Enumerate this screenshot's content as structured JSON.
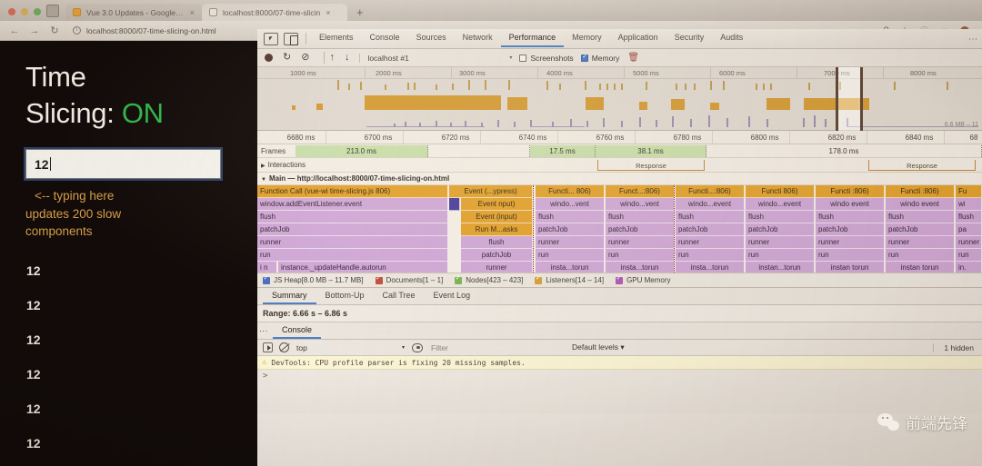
{
  "browser": {
    "tabs": [
      {
        "title": "Vue 3.0 Updates - Google Sli",
        "close": "×"
      },
      {
        "title": "localhost:8000/07-time-slicin",
        "close": "×"
      }
    ],
    "new_tab": "+",
    "back": "←",
    "forward": "→",
    "reload": "↻",
    "url": "localhost:8000/07-time-slicing-on.html",
    "info_icon": "i",
    "omni": {
      "search": "⚲",
      "bookmark": "☆",
      "account": "ⓘ",
      "extension": "▼"
    }
  },
  "page": {
    "title_line1": "Time",
    "title_line2": "Slicing: ",
    "title_state": "ON",
    "input_value": "12",
    "hint_arrow": "<-- typing here",
    "hint_line2": "updates 200 slow",
    "hint_line3": "components",
    "numbers": [
      "12",
      "12",
      "12",
      "12",
      "12",
      "12"
    ]
  },
  "devtools": {
    "tabs": [
      {
        "label": "Elements",
        "active": false
      },
      {
        "label": "Console",
        "active": false
      },
      {
        "label": "Sources",
        "active": false
      },
      {
        "label": "Network",
        "active": false
      },
      {
        "label": "Performance",
        "active": true
      },
      {
        "label": "Memory",
        "active": false
      },
      {
        "label": "Application",
        "active": false
      },
      {
        "label": "Security",
        "active": false
      },
      {
        "label": "Audits",
        "active": false
      }
    ],
    "kebab": "⋮",
    "controls": {
      "record": "record",
      "reload_record": "↻",
      "clear": "⊘",
      "upload": "↑",
      "download": "↓",
      "target": "localhost #1",
      "caret": "▾",
      "screenshots_label": "Screenshots",
      "screenshots_checked": false,
      "memory_label": "Memory",
      "memory_checked": true,
      "trash": "🗑"
    },
    "overview": {
      "ticks": [
        "1000 ms",
        "2000 ms",
        "3000 ms",
        "4000 ms",
        "5000 ms",
        "6000 ms",
        "7000 ms",
        "8000 ms"
      ],
      "heap_label": "6.6 MB – 11",
      "selection_label": "7000 ms"
    },
    "timeline": {
      "ticks": [
        "6680 ms",
        "6700 ms",
        "6720 ms",
        "6740 ms",
        "6760 ms",
        "6780 ms",
        "6800 ms",
        "6820 ms",
        "6840 ms",
        "68"
      ],
      "frames_label": "Frames",
      "frames": [
        "213.0 ms",
        "17.5 ms",
        "38.1 ms",
        "178.0 ms"
      ],
      "interactions_label": "Interactions",
      "interaction_items": [
        "Response",
        "Response"
      ],
      "main_label": "Main — http://localhost:8000/07-time-slicing-on.html",
      "expand_tri": "▶",
      "collapse_tri": "▼"
    },
    "flame": {
      "group_a": {
        "top": "Function Call (vue-wi  time-slicing.js 806)",
        "rows": [
          "window.addEventListener.event",
          "flush",
          "patchJob",
          "runner",
          "run",
          "instance._updateHandle.autorun"
        ],
        "row6_prefix": "i   n"
      },
      "group_b": {
        "rows": [
          "Event (...ypress)",
          "Event    nput)",
          "Event (input)",
          "Run M...asks",
          "flush",
          "patchJob",
          "runner"
        ]
      },
      "group_c": {
        "top": "Functi...  806)",
        "rows": [
          "windo...vent",
          "flush",
          "patchJob",
          "runner",
          "run",
          "insta...torun"
        ]
      },
      "group_d": {
        "top": "Funct...:806)",
        "rows": [
          "windo...vent",
          "flush",
          "patchJob",
          "runner",
          "run",
          "insta...torun"
        ]
      },
      "group_e": {
        "top": "Functi...:806)",
        "rows": [
          "windo...event",
          "flush",
          "patchJob",
          "runner",
          "run",
          "insta...torun"
        ]
      },
      "group_f": {
        "top": "Functi   806)",
        "rows": [
          "windo...event",
          "flush",
          "patchJob",
          "runner",
          "run",
          "instan...torun"
        ]
      },
      "group_g": {
        "top": "Functi   :806)",
        "rows": [
          "windo   event",
          "flush",
          "patchJob",
          "runner",
          "run",
          "instan   torun"
        ]
      },
      "group_h": {
        "top": "Functi   :806)",
        "rows": [
          "windo   event",
          "flush",
          "patchJob",
          "runner",
          "run",
          "instan  torun"
        ]
      },
      "group_i": {
        "top": "Fu",
        "rows": [
          "wi",
          "flush",
          "pa",
          "runner",
          "run",
          "in."
        ]
      }
    },
    "counters": [
      {
        "label": "JS Heap[8.0 MB – 11.7 MB]",
        "color": "#4a6fc4"
      },
      {
        "label": "Documents[1 – 1]",
        "color": "#c0503c"
      },
      {
        "label": "Nodes[423 – 423]",
        "color": "#79b554"
      },
      {
        "label": "Listeners[14 – 14]",
        "color": "#d8a03c"
      },
      {
        "label": "GPU Memory",
        "color": "#b05bb8"
      }
    ],
    "bottom_tabs": [
      {
        "label": "Summary",
        "active": true
      },
      {
        "label": "Bottom-Up",
        "active": false
      },
      {
        "label": "Call Tree",
        "active": false
      },
      {
        "label": "Event Log",
        "active": false
      }
    ],
    "range": "Range: 6.66 s – 6.86 s",
    "drawer": {
      "kebab": "⋮",
      "tab": "Console"
    },
    "console": {
      "context": "top",
      "caret": "▾",
      "filter_placeholder": "Filter",
      "levels": "Default levels ▾",
      "hidden": "1 hidden",
      "warning_icon": "⚠",
      "warning": "DevTools: CPU profile parser is fixing 20 missing samples.",
      "prompt": ">"
    }
  },
  "watermark": {
    "text": "前端先锋"
  },
  "colors": {
    "accent_blue": "#4f7fc4",
    "flame_orange": "#e2a22e",
    "flame_purple": "#d0a9d8",
    "frame_green": "#c8dfab",
    "on_green": "#2fb84a",
    "hint_orange": "#d8a14a"
  }
}
